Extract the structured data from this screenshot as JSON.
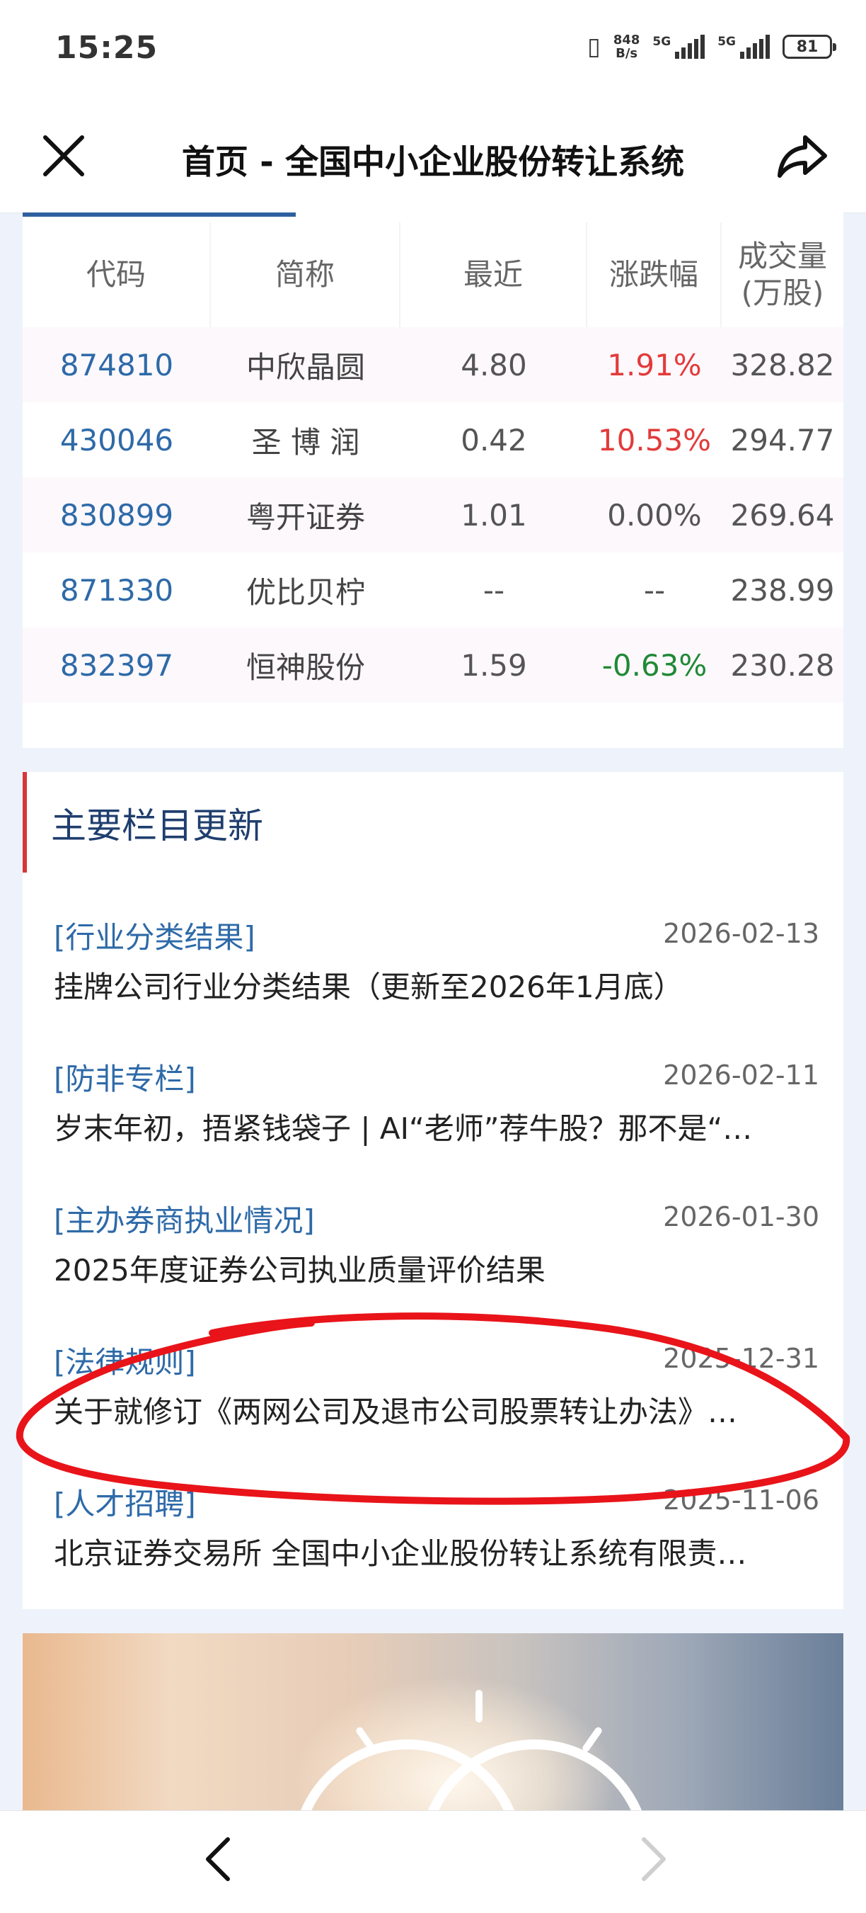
{
  "status_bar": {
    "time": "15:25",
    "net_speed_value": "848",
    "net_speed_unit": "B/s",
    "signal1_label": "5G",
    "signal2_label": "5G",
    "battery": "81"
  },
  "title_bar": {
    "title": "首页 - 全国中小企业股份转让系统",
    "close_icon": "close-icon",
    "share_icon": "share-icon"
  },
  "stock_table": {
    "headers": [
      "代码",
      "简称",
      "最近",
      "涨跌幅",
      "成交量\n(万股)"
    ],
    "rows": [
      {
        "code": "874810",
        "name": "中欣晶圆",
        "price": "4.80",
        "change": "1.91%",
        "volume": "328.82",
        "trend": "up"
      },
      {
        "code": "430046",
        "name": "圣 博 润",
        "price": "0.42",
        "change": "10.53%",
        "volume": "294.77",
        "trend": "up"
      },
      {
        "code": "830899",
        "name": "粤开证券",
        "price": "1.01",
        "change": "0.00%",
        "volume": "269.64",
        "trend": "flat"
      },
      {
        "code": "871330",
        "name": "优比贝柠",
        "price": "--",
        "change": "--",
        "volume": "238.99",
        "trend": "flat"
      },
      {
        "code": "832397",
        "name": "恒神股份",
        "price": "1.59",
        "change": "-0.63%",
        "volume": "230.28",
        "trend": "down"
      }
    ]
  },
  "updates": {
    "title": "主要栏目更新",
    "items": [
      {
        "category": "[行业分类结果]",
        "date": "2026-02-13",
        "text": "挂牌公司行业分类结果（更新至2026年1月底）"
      },
      {
        "category": "[防非专栏]",
        "date": "2026-02-11",
        "text": "岁末年初，捂紧钱袋子 | AI“老师”荐牛股？那不是“…"
      },
      {
        "category": "[主办券商执业情况]",
        "date": "2026-01-30",
        "text": "2025年度证券公司执业质量评价结果"
      },
      {
        "category": "[法律规则]",
        "date": "2025-12-31",
        "text": "关于就修订《两网公司及退市公司股票转让办法》…"
      },
      {
        "category": "[人才招聘]",
        "date": "2025-11-06",
        "text": "北京证券交易所 全国中小企业股份转让系统有限责…"
      }
    ]
  },
  "colors": {
    "up": "#e23b3b",
    "down": "#1f8a36",
    "code": "#2e6aa8",
    "accent": "#d8353a",
    "annotation": "#e8141a"
  },
  "bottom_nav": {
    "back_icon": "chevron-left-icon",
    "forward_icon": "chevron-right-icon"
  }
}
